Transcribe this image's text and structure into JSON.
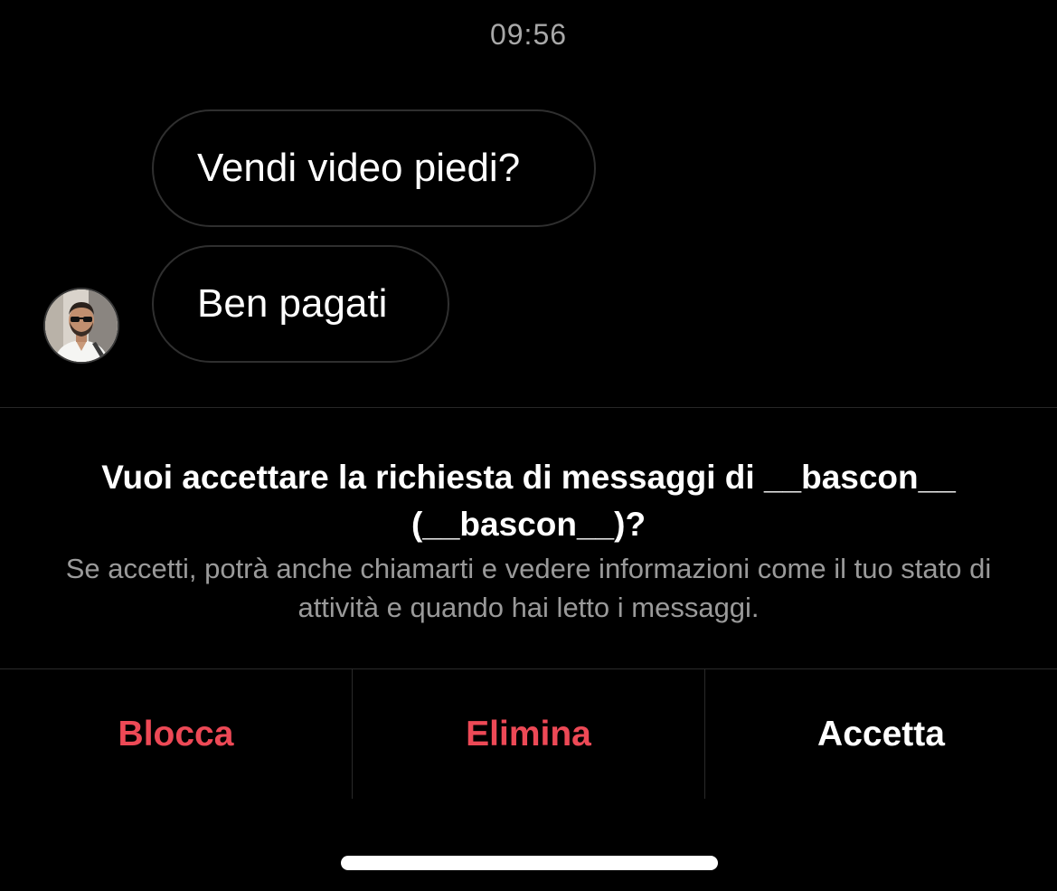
{
  "thread": {
    "timestamp": "09:56",
    "messages": [
      {
        "text": "Vendi video piedi?"
      },
      {
        "text": "Ben pagati"
      }
    ],
    "sender_avatar_icon": "user-avatar-photo"
  },
  "request": {
    "title": "Vuoi accettare la richiesta di messaggi di __bascon__ (__bascon__)?",
    "description": "Se accetti, potrà anche chiamarti e vedere informazioni come il tuo stato di attività e quando hai letto i messaggi."
  },
  "actions": {
    "block_label": "Blocca",
    "delete_label": "Elimina",
    "accept_label": "Accetta"
  },
  "colors": {
    "background": "#000000",
    "danger": "#ed4956",
    "primary_text": "#ffffff",
    "secondary_text": "#9a9a9a"
  }
}
